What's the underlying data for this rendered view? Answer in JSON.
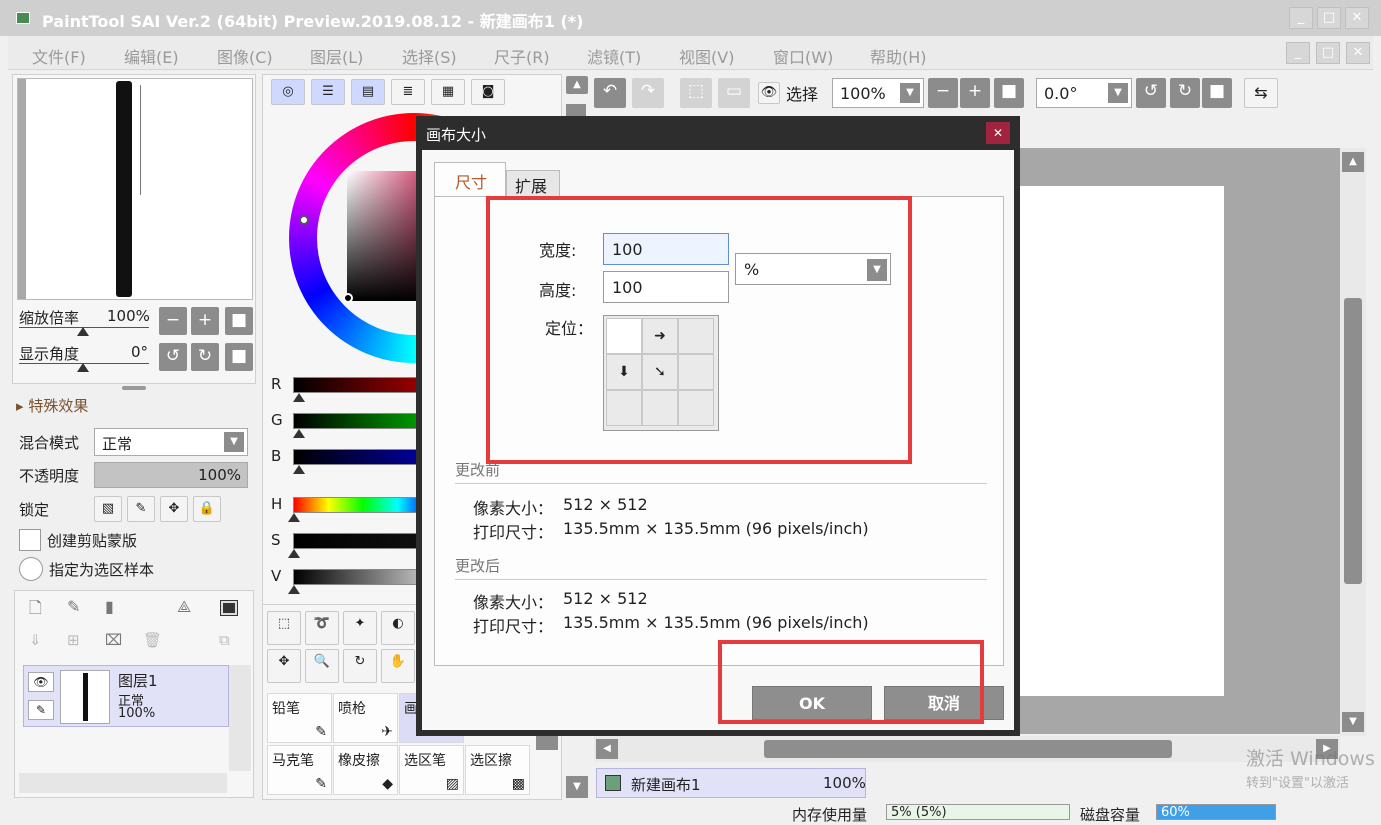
{
  "window": {
    "title": "PaintTool SAI Ver.2 (64bit) Preview.2019.08.12 - 新建画布1 (*)",
    "minimize": "_",
    "maximize": "□",
    "close": "✕"
  },
  "menu": {
    "items": [
      "文件(F)",
      "编辑(E)",
      "图像(C)",
      "图层(L)",
      "选择(S)",
      "尺子(R)",
      "滤镜(T)",
      "视图(V)",
      "窗口(W)",
      "帮助(H)"
    ]
  },
  "navigator": {
    "zoom_label": "缩放倍率",
    "zoom_value": "100%",
    "angle_label": "显示角度",
    "angle_value": "0°"
  },
  "layer_panel": {
    "effects_label": "特殊效果",
    "blend_label": "混合模式",
    "blend_value": "正常",
    "opacity_label": "不透明度",
    "opacity_value": "100%",
    "lock_label": "锁定",
    "clip_label": "创建剪贴蒙版",
    "sample_label": "指定为选区样本",
    "layer_name": "图层1",
    "layer_mode": "正常",
    "layer_opacity": "100%"
  },
  "color_sliders": [
    "R",
    "G",
    "B",
    "H",
    "S",
    "V"
  ],
  "tools": {
    "row1": [
      "铅笔",
      "喷枪",
      "画"
    ],
    "row2": [
      "马克笔",
      "橡皮擦",
      "选区笔",
      "选区擦"
    ]
  },
  "toolbar": {
    "select_label": "选择",
    "zoom_value": "100%",
    "angle_value": "0.0°"
  },
  "canvas_tab": {
    "name": "新建画布1",
    "zoom": "100%"
  },
  "status": {
    "memory_label": "内存使用量",
    "memory_value": "5% (5%)",
    "disk_label": "磁盘容量",
    "disk_value": "60%"
  },
  "watermark": {
    "line1": "激活 Windows",
    "line2": "转到\"设置\"以激活"
  },
  "dialog": {
    "title": "画布大小",
    "close": "✕",
    "tab_size": "尺寸",
    "tab_expand": "扩展",
    "width_label": "宽度:",
    "width_value": "100",
    "height_label": "高度:",
    "height_value": "100",
    "unit_value": "%",
    "anchor_label": "定位：",
    "before_title": "更改前",
    "before_pixel_label": "像素大小：",
    "before_pixel_value": "512 × 512",
    "before_print_label": "打印尺寸：",
    "before_print_value": "135.5mm × 135.5mm (96 pixels/inch)",
    "after_title": "更改后",
    "after_pixel_label": "像素大小：",
    "after_pixel_value": "512 × 512",
    "after_print_label": "打印尺寸：",
    "after_print_value": "135.5mm × 135.5mm (96 pixels/inch)",
    "ok": "OK",
    "cancel": "取消"
  },
  "colors": {
    "highlight_red": "#e53b3b",
    "dialog_dark": "#2d2d2d",
    "button_gray": "#8e8e8e"
  }
}
